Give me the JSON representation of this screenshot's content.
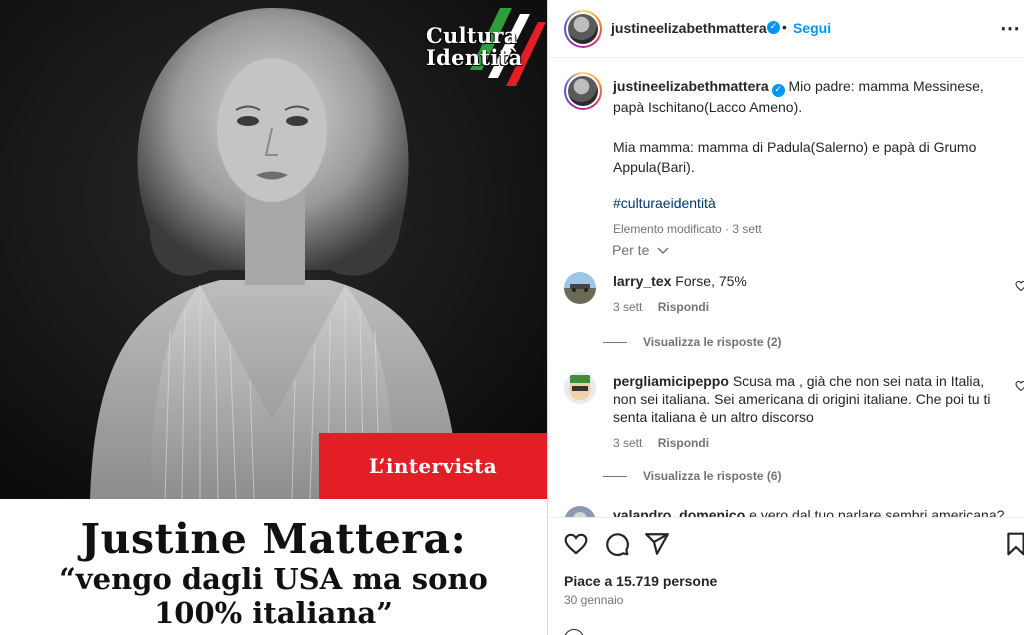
{
  "post_image": {
    "logo": {
      "line1": "Cultura",
      "line2": "Identità"
    },
    "badge": "L’intervista",
    "headline": {
      "name": "Justine Mattera:",
      "quote_line1": "“vengo dagli USA ma sono",
      "quote_line2": "100% italiana”"
    }
  },
  "header": {
    "username": "justineelizabethmattera",
    "separator": "•",
    "follow": "Segui",
    "more_icon": "more-horizontal-icon"
  },
  "caption": {
    "username": "justineelizabethmattera",
    "text_para1": "Mio padre: mamma Messinese, papà Ischitano(Lacco Ameno).",
    "text_para2": "Mia mamma: mamma di Padula(Salerno) e papà di Grumo Appula(Bari).",
    "hashtag": "#culturaeidentità",
    "meta": "Elemento modificato · 3 sett"
  },
  "for_you": "Per te",
  "comments": [
    {
      "username": "larry_tex",
      "text": "Forse, 75%",
      "time": "3 sett",
      "reply": "Rispondi",
      "view_replies": "Visualizza le risposte (2)"
    },
    {
      "username": "pergliamicipeppo",
      "text": "Scusa ma , già che non sei nata in Italia, non sei italiana. Sei americana di origini italiane. Che poi tu ti senta italiana è un altro discorso",
      "time": "3 sett",
      "reply": "Rispondi",
      "view_replies": "Visualizza le risposte (6)"
    },
    {
      "username": "valandro_domenico",
      "text": "e vero dal tuo parlare sembri americana?"
    }
  ],
  "actions": {
    "likes": "Piace a 15.719 persone",
    "date": "30 gennaio"
  },
  "colors": {
    "accent": "#0095f6",
    "badge_red": "#e31e24",
    "hashtag": "#00376b"
  }
}
